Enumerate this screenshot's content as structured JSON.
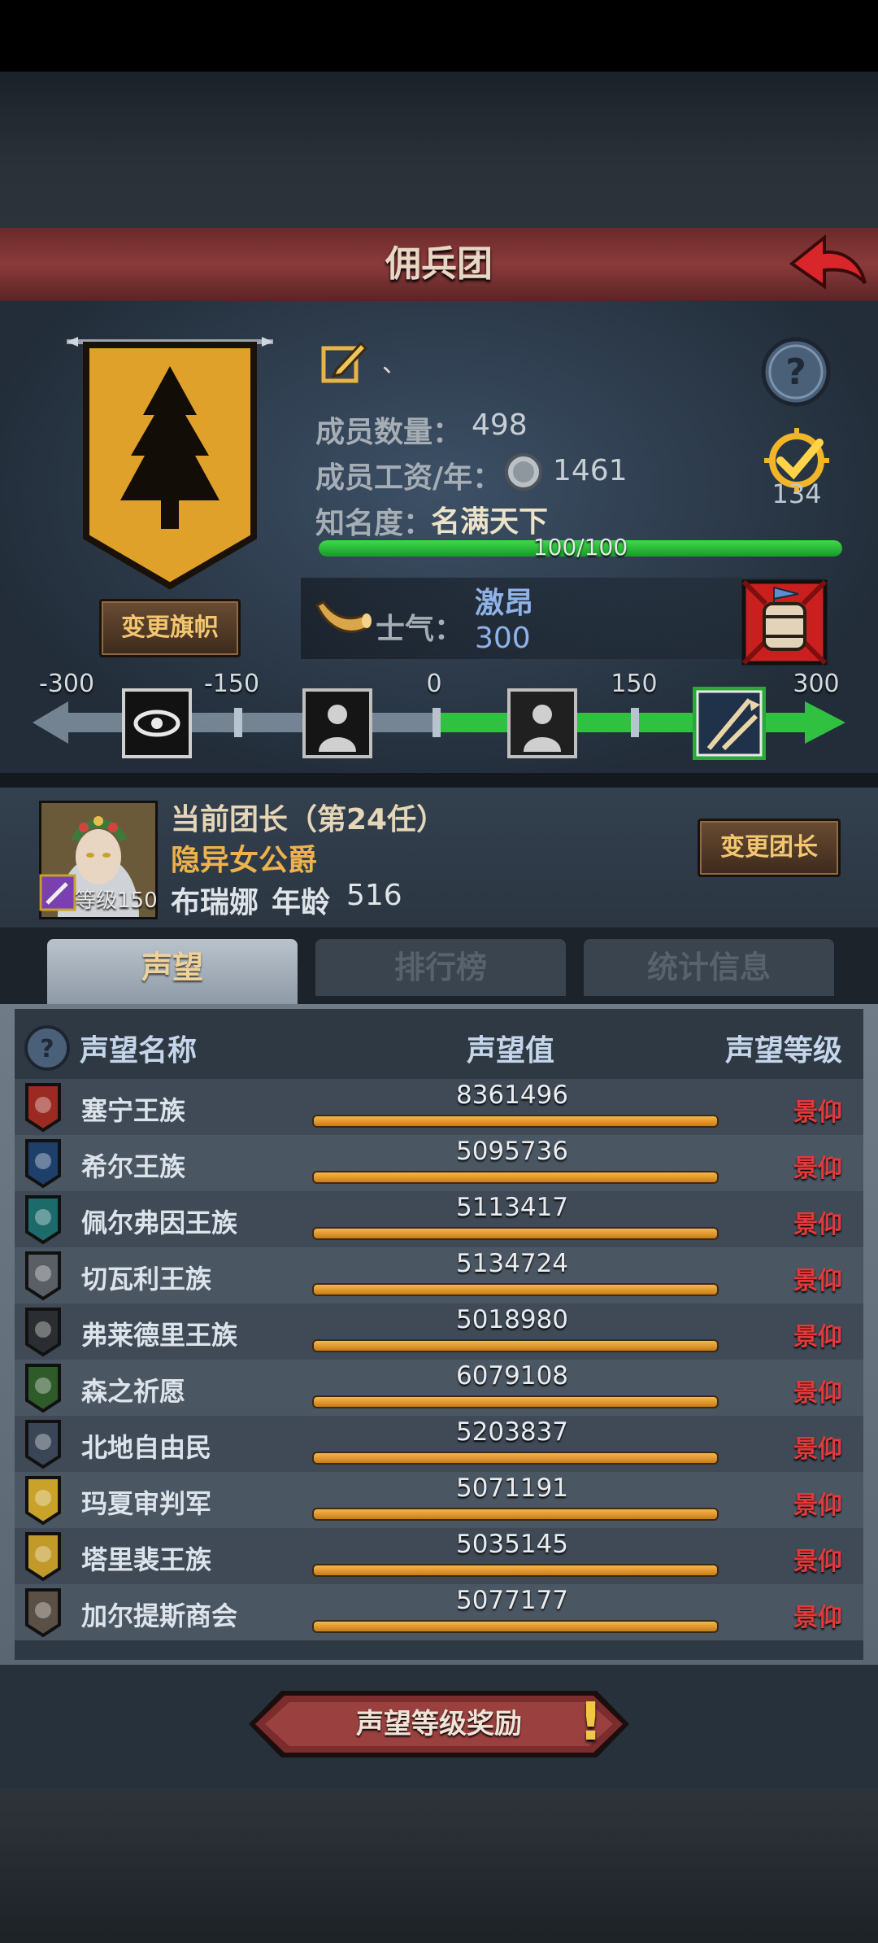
{
  "header": {
    "title": "佣兵团"
  },
  "company": {
    "members_label": "成员数量：",
    "members_value": "498",
    "wage_label": "成员工资/年：",
    "wage_value": "1461",
    "fame_label": "知名度：",
    "fame_value": "名满天下",
    "fame_progress": "100/100",
    "fame_fraction": 1.0,
    "badge_count": "134",
    "change_banner_label": "变更旗帜",
    "edit_suffix": "、"
  },
  "morale": {
    "label": "士气：",
    "state": "激昂",
    "value": "300",
    "scale_ticks": [
      "-300",
      "-150",
      "0",
      "150",
      "300"
    ]
  },
  "leader": {
    "title": "当前团长（第24任）",
    "rank": "隐异女公爵",
    "name": "布瑞娜",
    "age_label": "年龄",
    "age": "516",
    "level_label": "等级150",
    "change_leader_label": "变更团长"
  },
  "tabs": [
    {
      "label": "声望",
      "active": true
    },
    {
      "label": "排行榜",
      "active": false
    },
    {
      "label": "统计信息",
      "active": false
    }
  ],
  "reputation": {
    "headers": {
      "name": "声望名称",
      "value": "声望值",
      "level": "声望等级"
    },
    "rows": [
      {
        "name": "塞宁王族",
        "value": "8361496",
        "level": "景仰",
        "icon": "red-crest-icon",
        "color": "#9b2a22"
      },
      {
        "name": "希尔王族",
        "value": "5095736",
        "level": "景仰",
        "icon": "blue-helmet-icon",
        "color": "#1f3f6b"
      },
      {
        "name": "佩尔弗因王族",
        "value": "5113417",
        "level": "景仰",
        "icon": "teal-moon-icon",
        "color": "#1c6b6a"
      },
      {
        "name": "切瓦利王族",
        "value": "5134724",
        "level": "景仰",
        "icon": "scales-icon",
        "color": "#5a5f66"
      },
      {
        "name": "弗莱德里王族",
        "value": "5018980",
        "level": "景仰",
        "icon": "dark-beast-icon",
        "color": "#2a2d31"
      },
      {
        "name": "森之祈愿",
        "value": "6079108",
        "level": "景仰",
        "icon": "tree-icon",
        "color": "#2f5a2a"
      },
      {
        "name": "北地自由民",
        "value": "5203837",
        "level": "景仰",
        "icon": "axe-icon",
        "color": "#3a4656"
      },
      {
        "name": "玛夏审判军",
        "value": "5071191",
        "level": "景仰",
        "icon": "gold-chevron-icon",
        "color": "#c9a22a"
      },
      {
        "name": "塔里裴王族",
        "value": "5035145",
        "level": "景仰",
        "icon": "gold-crown-icon",
        "color": "#c29a2a"
      },
      {
        "name": "加尔提斯商会",
        "value": "5077177",
        "level": "景仰",
        "icon": "chest-icon",
        "color": "#5a5046"
      }
    ]
  },
  "reward_button_label": "声望等级奖励",
  "colors": {
    "accent_red": "#e23a3a",
    "bar_orange": "#f6b84a",
    "fame_green": "#3ed94a",
    "morale_blue": "#8fb2e8"
  }
}
